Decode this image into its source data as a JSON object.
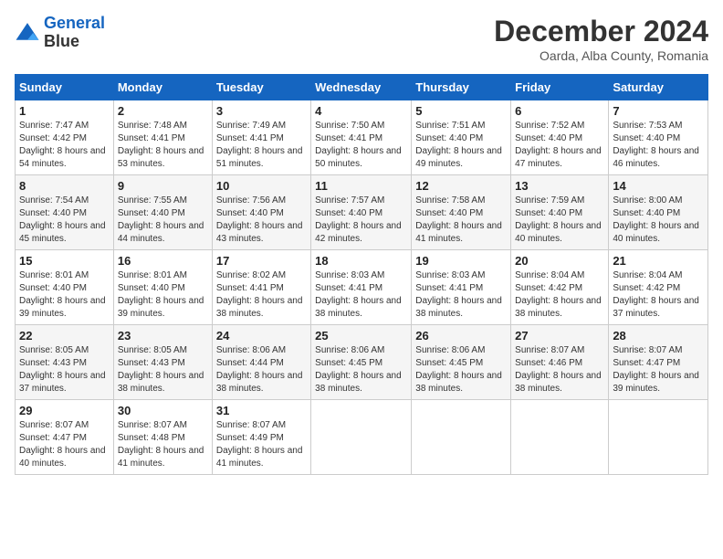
{
  "logo": {
    "line1": "General",
    "line2": "Blue"
  },
  "title": "December 2024",
  "location": "Oarda, Alba County, Romania",
  "headers": [
    "Sunday",
    "Monday",
    "Tuesday",
    "Wednesday",
    "Thursday",
    "Friday",
    "Saturday"
  ],
  "weeks": [
    [
      {
        "day": "1",
        "sunrise": "7:47 AM",
        "sunset": "4:42 PM",
        "daylight": "8 hours and 54 minutes."
      },
      {
        "day": "2",
        "sunrise": "7:48 AM",
        "sunset": "4:41 PM",
        "daylight": "8 hours and 53 minutes."
      },
      {
        "day": "3",
        "sunrise": "7:49 AM",
        "sunset": "4:41 PM",
        "daylight": "8 hours and 51 minutes."
      },
      {
        "day": "4",
        "sunrise": "7:50 AM",
        "sunset": "4:41 PM",
        "daylight": "8 hours and 50 minutes."
      },
      {
        "day": "5",
        "sunrise": "7:51 AM",
        "sunset": "4:40 PM",
        "daylight": "8 hours and 49 minutes."
      },
      {
        "day": "6",
        "sunrise": "7:52 AM",
        "sunset": "4:40 PM",
        "daylight": "8 hours and 47 minutes."
      },
      {
        "day": "7",
        "sunrise": "7:53 AM",
        "sunset": "4:40 PM",
        "daylight": "8 hours and 46 minutes."
      }
    ],
    [
      {
        "day": "8",
        "sunrise": "7:54 AM",
        "sunset": "4:40 PM",
        "daylight": "8 hours and 45 minutes."
      },
      {
        "day": "9",
        "sunrise": "7:55 AM",
        "sunset": "4:40 PM",
        "daylight": "8 hours and 44 minutes."
      },
      {
        "day": "10",
        "sunrise": "7:56 AM",
        "sunset": "4:40 PM",
        "daylight": "8 hours and 43 minutes."
      },
      {
        "day": "11",
        "sunrise": "7:57 AM",
        "sunset": "4:40 PM",
        "daylight": "8 hours and 42 minutes."
      },
      {
        "day": "12",
        "sunrise": "7:58 AM",
        "sunset": "4:40 PM",
        "daylight": "8 hours and 41 minutes."
      },
      {
        "day": "13",
        "sunrise": "7:59 AM",
        "sunset": "4:40 PM",
        "daylight": "8 hours and 40 minutes."
      },
      {
        "day": "14",
        "sunrise": "8:00 AM",
        "sunset": "4:40 PM",
        "daylight": "8 hours and 40 minutes."
      }
    ],
    [
      {
        "day": "15",
        "sunrise": "8:01 AM",
        "sunset": "4:40 PM",
        "daylight": "8 hours and 39 minutes."
      },
      {
        "day": "16",
        "sunrise": "8:01 AM",
        "sunset": "4:40 PM",
        "daylight": "8 hours and 39 minutes."
      },
      {
        "day": "17",
        "sunrise": "8:02 AM",
        "sunset": "4:41 PM",
        "daylight": "8 hours and 38 minutes."
      },
      {
        "day": "18",
        "sunrise": "8:03 AM",
        "sunset": "4:41 PM",
        "daylight": "8 hours and 38 minutes."
      },
      {
        "day": "19",
        "sunrise": "8:03 AM",
        "sunset": "4:41 PM",
        "daylight": "8 hours and 38 minutes."
      },
      {
        "day": "20",
        "sunrise": "8:04 AM",
        "sunset": "4:42 PM",
        "daylight": "8 hours and 38 minutes."
      },
      {
        "day": "21",
        "sunrise": "8:04 AM",
        "sunset": "4:42 PM",
        "daylight": "8 hours and 37 minutes."
      }
    ],
    [
      {
        "day": "22",
        "sunrise": "8:05 AM",
        "sunset": "4:43 PM",
        "daylight": "8 hours and 37 minutes."
      },
      {
        "day": "23",
        "sunrise": "8:05 AM",
        "sunset": "4:43 PM",
        "daylight": "8 hours and 38 minutes."
      },
      {
        "day": "24",
        "sunrise": "8:06 AM",
        "sunset": "4:44 PM",
        "daylight": "8 hours and 38 minutes."
      },
      {
        "day": "25",
        "sunrise": "8:06 AM",
        "sunset": "4:45 PM",
        "daylight": "8 hours and 38 minutes."
      },
      {
        "day": "26",
        "sunrise": "8:06 AM",
        "sunset": "4:45 PM",
        "daylight": "8 hours and 38 minutes."
      },
      {
        "day": "27",
        "sunrise": "8:07 AM",
        "sunset": "4:46 PM",
        "daylight": "8 hours and 38 minutes."
      },
      {
        "day": "28",
        "sunrise": "8:07 AM",
        "sunset": "4:47 PM",
        "daylight": "8 hours and 39 minutes."
      }
    ],
    [
      {
        "day": "29",
        "sunrise": "8:07 AM",
        "sunset": "4:47 PM",
        "daylight": "8 hours and 40 minutes."
      },
      {
        "day": "30",
        "sunrise": "8:07 AM",
        "sunset": "4:48 PM",
        "daylight": "8 hours and 41 minutes."
      },
      {
        "day": "31",
        "sunrise": "8:07 AM",
        "sunset": "4:49 PM",
        "daylight": "8 hours and 41 minutes."
      },
      null,
      null,
      null,
      null
    ]
  ],
  "labels": {
    "sunrise": "Sunrise:",
    "sunset": "Sunset:",
    "daylight": "Daylight:"
  }
}
